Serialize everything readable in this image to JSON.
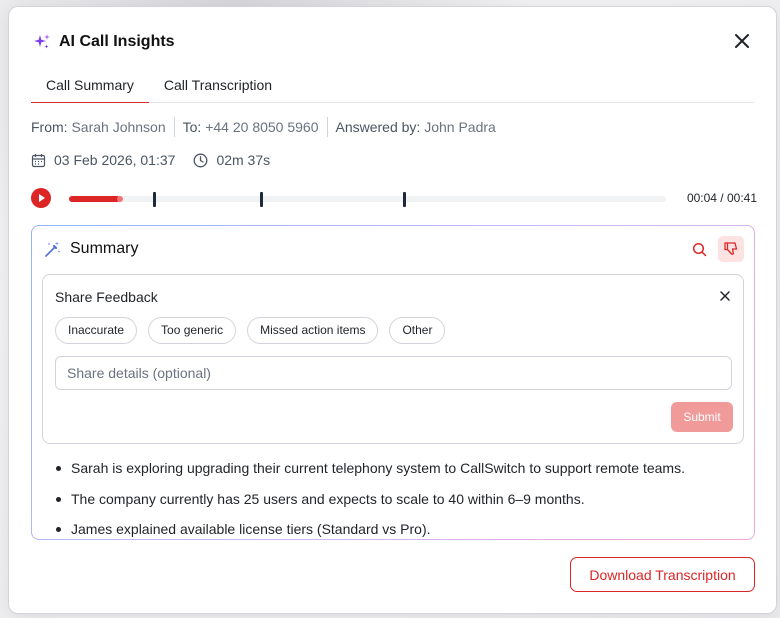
{
  "modal": {
    "title": "AI Call Insights",
    "accent_color": "#dc2626",
    "icons": {
      "title": "sparkle-icon",
      "close": "close-icon"
    }
  },
  "tabs": [
    {
      "label": "Call Summary",
      "active": true
    },
    {
      "label": "Call Transcription",
      "active": false
    }
  ],
  "call": {
    "from_label": "From:",
    "from": "Sarah Johnson",
    "to_label": "To:",
    "to": "+44 20 8050 5960",
    "answered_label": "Answered by:",
    "answered_by": "John Padra",
    "date": "03 Feb 2026, 01:37",
    "duration": "02m 37s"
  },
  "player": {
    "time": "00:04 / 00:41",
    "progress_fraction": 0.085,
    "marker_fractions": [
      0.14,
      0.32,
      0.56
    ]
  },
  "summary": {
    "title": "Summary",
    "bullets": [
      "Sarah is exploring upgrading their current telephony system to CallSwitch to support remote teams.",
      "The company currently has 25 users and expects to scale to 40 within 6–9 months.",
      "James explained available license tiers (Standard vs Pro)."
    ]
  },
  "feedback": {
    "title": "Share Feedback",
    "chips": [
      "Inaccurate",
      "Too generic",
      "Missed action items",
      "Other"
    ],
    "placeholder": "Share details (optional)",
    "submit_label": "Submit"
  },
  "footer": {
    "download_label": "Download Transcription"
  }
}
